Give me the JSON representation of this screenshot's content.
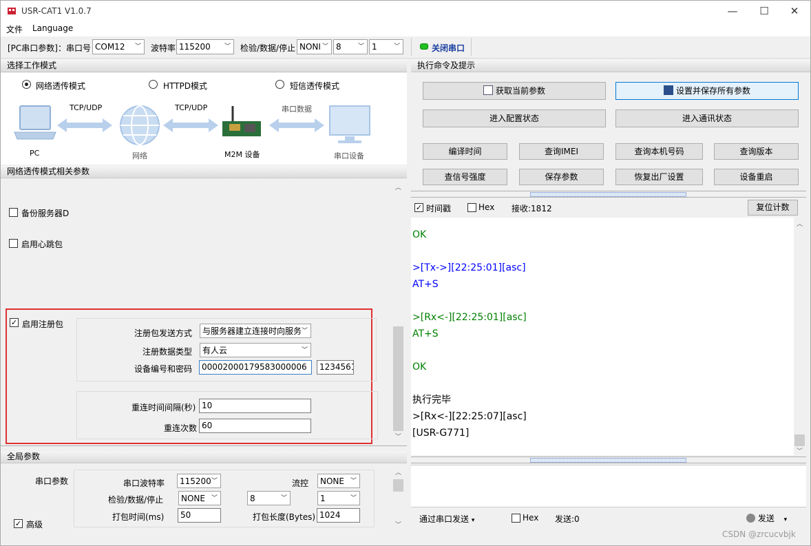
{
  "window": {
    "title": "USR-CAT1 V1.0.7",
    "minimize": "—",
    "maximize": "☐",
    "close": "✕"
  },
  "menu": [
    "文件",
    "Language"
  ],
  "toolbar": {
    "pc_params_label": "[PC串口参数]：串口号",
    "port": "COM12",
    "baud_label": "波特率",
    "baud": "115200",
    "check_label": "检验/数据/停止",
    "parity": "NONI",
    "databits": "8",
    "stopbits": "1",
    "close_port": "关闭串口",
    "port_status_color": "#1fbf1f"
  },
  "mode": {
    "header": "选择工作模式",
    "options": [
      {
        "label": "网络透传模式",
        "selected": true
      },
      {
        "label": "HTTPD模式",
        "selected": false
      },
      {
        "label": "短信透传模式",
        "selected": false
      }
    ],
    "diagram": {
      "pc": "PC",
      "net": "网络",
      "m2m": "M2M 设备",
      "serial_dev": "串口设备",
      "link1": "TCP/UDP",
      "link2": "TCP/UDP",
      "link3": "串口数据"
    }
  },
  "net_params": {
    "header": "网络透传模式相关参数",
    "backup_server": "备份服务器D",
    "backup_checked": false,
    "heartbeat": "启用心跳包",
    "heartbeat_checked": false,
    "register": "启用注册包",
    "register_checked": true,
    "reg_send_label": "注册包发送方式",
    "reg_send_value": "与服务器建立连接时向服务",
    "reg_type_label": "注册数据类型",
    "reg_type_value": "有人云",
    "device_label": "设备编号和密码",
    "device_id": "00002000179583000006",
    "device_pwd": "1234561",
    "reconnect_interval_label": "重连时间间隔(秒)",
    "reconnect_interval": "10",
    "reconnect_count_label": "重连次数",
    "reconnect_count": "60"
  },
  "global": {
    "header": "全局参数",
    "serial_params": "串口参数",
    "baud_label": "串口波特率",
    "baud": "115200",
    "flow_label": "流控",
    "flow": "NONE",
    "check_label": "检验/数据/停止",
    "parity": "NONE",
    "databits": "8",
    "stopbits": "1",
    "pack_time_label": "打包时间(ms)",
    "pack_time": "50",
    "pack_len_label": "打包长度(Bytes)",
    "pack_len": "1024",
    "advanced": "高级",
    "advanced_checked": true
  },
  "commands": {
    "header": "执行命令及提示",
    "get_params": "获取当前参数",
    "save_all": "设置并保存所有参数",
    "enter_config": "进入配置状态",
    "enter_comm": "进入通讯状态",
    "row1": [
      "编译时间",
      "查询IMEI",
      "查询本机号码",
      "查询版本"
    ],
    "row2": [
      "查信号强度",
      "保存参数",
      "恢复出厂设置",
      "设备重启"
    ]
  },
  "log": {
    "timestamp_label": "时间戳",
    "timestamp_checked": true,
    "hex_label": "Hex",
    "hex_checked": false,
    "recv_label": "接收:1812",
    "reset": "复位计数",
    "lines": [
      {
        "text": "OK",
        "color": "#008000"
      },
      {
        "text": "",
        "color": "#000"
      },
      {
        "text": ">[Tx->][22:25:01][asc]",
        "color": "#0000ff"
      },
      {
        "text": "AT+S",
        "color": "#0000ff"
      },
      {
        "text": "",
        "color": "#000"
      },
      {
        "text": ">[Rx<-][22:25:01][asc]",
        "color": "#008000"
      },
      {
        "text": "AT+S",
        "color": "#008000"
      },
      {
        "text": "",
        "color": "#000"
      },
      {
        "text": "OK",
        "color": "#008000"
      },
      {
        "text": "",
        "color": "#000"
      },
      {
        "text": "执行完毕",
        "color": "#000000"
      },
      {
        "text": ">[Rx<-][22:25:07][asc]",
        "color": "#000000"
      },
      {
        "text": "[USR-G771]",
        "color": "#000000"
      }
    ]
  },
  "send": {
    "via": "通过串口发送",
    "hex": "Hex",
    "sent": "发送:0",
    "send_btn": "发送"
  },
  "watermark": "CSDN @zrcucvbjk"
}
